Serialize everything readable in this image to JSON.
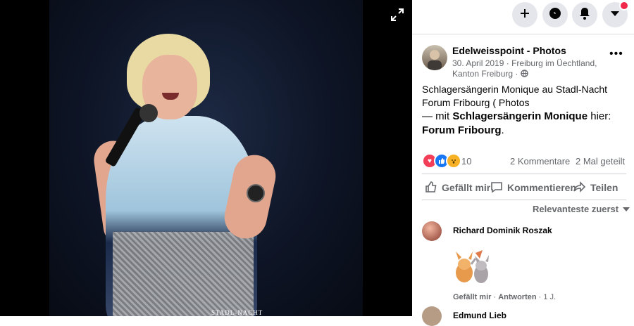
{
  "photo": {
    "watermark": "STADL-NACHT"
  },
  "topbar": {
    "buttons": [
      {
        "icon": "plus-icon"
      },
      {
        "icon": "messenger-icon"
      },
      {
        "icon": "bell-icon"
      },
      {
        "icon": "caret-down-icon",
        "has_badge": true
      }
    ]
  },
  "post": {
    "page_name": "Edelweisspoint - Photos",
    "date": "30. April 2019",
    "location_line1": "Freiburg im Üechtland,",
    "location_line2": "Kanton Freiburg",
    "caption": "Schlagersängerin Monique au Stadl-Nacht Forum Fribourg ( Photos",
    "tag_prefix": "— mit ",
    "tag_person": "Schlagersängerin Monique",
    "tag_middle": " hier: ",
    "tag_place": "Forum Fribourg",
    "tag_suffix": ".",
    "reaction_count": "10",
    "comments_count": "2 Kommentare",
    "shares_count": "2 Mal geteilt",
    "reaction_colors": {
      "love": "#f33e58",
      "like": "#1877f2",
      "wow": "#f7b125"
    }
  },
  "actions": {
    "like": "Gefällt mir",
    "comment": "Kommentieren",
    "share": "Teilen"
  },
  "comments": {
    "sort_label": "Relevanteste zuerst",
    "items": [
      {
        "author": "Richard Dominik Roszak",
        "like_label": "Gefällt mir",
        "reply_label": "Antworten",
        "age": "1 J."
      },
      {
        "author": "Edmund Lieb"
      }
    ]
  }
}
